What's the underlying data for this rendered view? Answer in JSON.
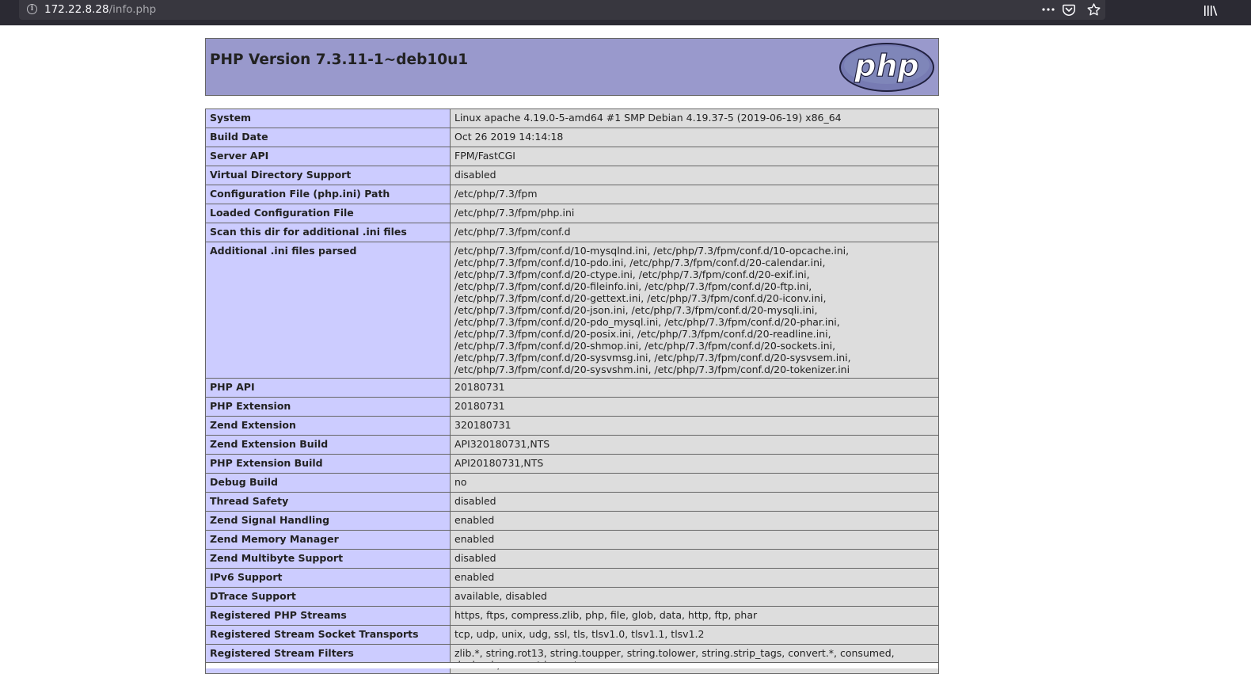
{
  "browser": {
    "url_host": "172.22.8.28",
    "url_path": "/info.php"
  },
  "header": {
    "title": "PHP Version 7.3.11-1~deb10u1",
    "logo_text": "php"
  },
  "rows": [
    {
      "label": "System",
      "value": "Linux apache 4.19.0-5-amd64 #1 SMP Debian 4.19.37-5 (2019-06-19) x86_64"
    },
    {
      "label": "Build Date",
      "value": "Oct 26 2019 14:14:18"
    },
    {
      "label": "Server API",
      "value": "FPM/FastCGI"
    },
    {
      "label": "Virtual Directory Support",
      "value": "disabled"
    },
    {
      "label": "Configuration File (php.ini) Path",
      "value": "/etc/php/7.3/fpm"
    },
    {
      "label": "Loaded Configuration File",
      "value": "/etc/php/7.3/fpm/php.ini"
    },
    {
      "label": "Scan this dir for additional .ini files",
      "value": "/etc/php/7.3/fpm/conf.d"
    },
    {
      "label": "Additional .ini files parsed",
      "value": "/etc/php/7.3/fpm/conf.d/10-mysqlnd.ini, /etc/php/7.3/fpm/conf.d/10-opcache.ini, /etc/php/7.3/fpm/conf.d/10-pdo.ini, /etc/php/7.3/fpm/conf.d/20-calendar.ini, /etc/php/7.3/fpm/conf.d/20-ctype.ini, /etc/php/7.3/fpm/conf.d/20-exif.ini, /etc/php/7.3/fpm/conf.d/20-fileinfo.ini, /etc/php/7.3/fpm/conf.d/20-ftp.ini, /etc/php/7.3/fpm/conf.d/20-gettext.ini, /etc/php/7.3/fpm/conf.d/20-iconv.ini, /etc/php/7.3/fpm/conf.d/20-json.ini, /etc/php/7.3/fpm/conf.d/20-mysqli.ini, /etc/php/7.3/fpm/conf.d/20-pdo_mysql.ini, /etc/php/7.3/fpm/conf.d/20-phar.ini, /etc/php/7.3/fpm/conf.d/20-posix.ini, /etc/php/7.3/fpm/conf.d/20-readline.ini, /etc/php/7.3/fpm/conf.d/20-shmop.ini, /etc/php/7.3/fpm/conf.d/20-sockets.ini, /etc/php/7.3/fpm/conf.d/20-sysvmsg.ini, /etc/php/7.3/fpm/conf.d/20-sysvsem.ini, /etc/php/7.3/fpm/conf.d/20-sysvshm.ini, /etc/php/7.3/fpm/conf.d/20-tokenizer.ini"
    },
    {
      "label": "PHP API",
      "value": "20180731"
    },
    {
      "label": "PHP Extension",
      "value": "20180731"
    },
    {
      "label": "Zend Extension",
      "value": "320180731"
    },
    {
      "label": "Zend Extension Build",
      "value": "API320180731,NTS"
    },
    {
      "label": "PHP Extension Build",
      "value": "API20180731,NTS"
    },
    {
      "label": "Debug Build",
      "value": "no"
    },
    {
      "label": "Thread Safety",
      "value": "disabled"
    },
    {
      "label": "Zend Signal Handling",
      "value": "enabled"
    },
    {
      "label": "Zend Memory Manager",
      "value": "enabled"
    },
    {
      "label": "Zend Multibyte Support",
      "value": "disabled"
    },
    {
      "label": "IPv6 Support",
      "value": "enabled"
    },
    {
      "label": "DTrace Support",
      "value": "available, disabled"
    },
    {
      "label": "Registered PHP Streams",
      "value": "https, ftps, compress.zlib, php, file, glob, data, http, ftp, phar"
    },
    {
      "label": "Registered Stream Socket Transports",
      "value": "tcp, udp, unix, udg, ssl, tls, tlsv1.0, tlsv1.1, tlsv1.2"
    },
    {
      "label": "Registered Stream Filters",
      "value": "zlib.*, string.rot13, string.toupper, string.tolower, string.strip_tags, convert.*, consumed, dechunk, convert.iconv.*"
    }
  ],
  "icons": {
    "page_info": "info-icon",
    "page_actions": "more-icon",
    "pocket": "pocket-icon",
    "bookmark": "star-icon",
    "library": "library-icon"
  },
  "colors": {
    "header_bg": "#9999cc",
    "label_bg": "#ccccff",
    "value_bg": "#dddddd",
    "toolbar_bg": "#2b2a33"
  }
}
